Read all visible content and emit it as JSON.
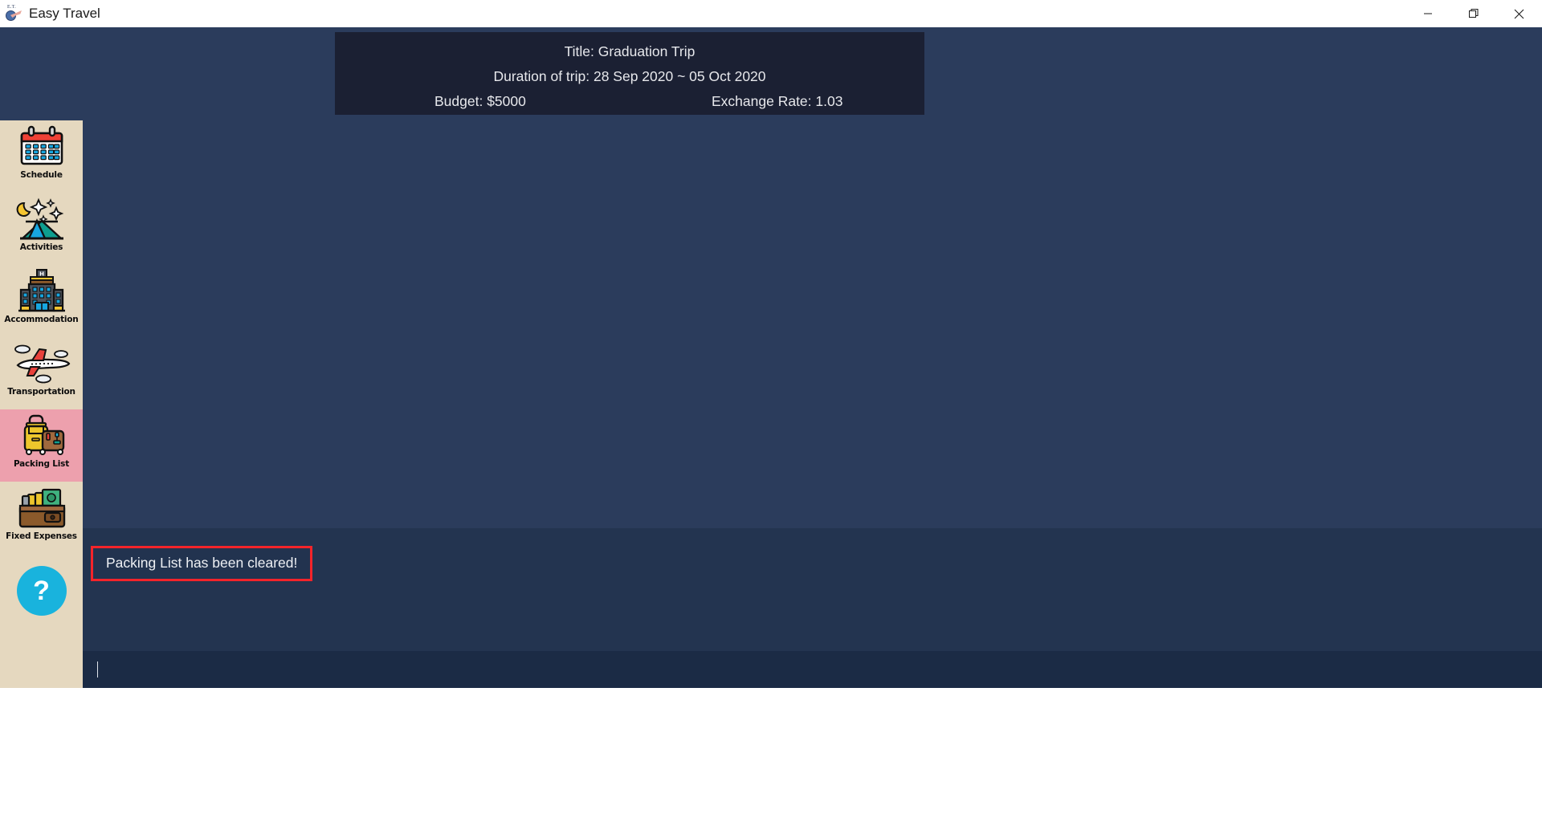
{
  "window": {
    "title": "Easy Travel",
    "icon": "app-logo-icon",
    "minimize_label": "Minimize",
    "maximize_label": "Restore",
    "close_label": "Close"
  },
  "header": {
    "title_line": "Title: Graduation Trip",
    "duration_line": "Duration of trip: 28 Sep 2020 ~ 05 Oct 2020",
    "budget_line": "Budget: $5000",
    "exchange_rate_line": "Exchange Rate: 1.03",
    "background_color": "#1b2033"
  },
  "sidebar": {
    "background_color": "#e5d8bf",
    "selected_color": "#eda0ad",
    "items": [
      {
        "label": "Schedule",
        "icon": "calendar-icon",
        "selected": false
      },
      {
        "label": "Activities",
        "icon": "tent-night-icon",
        "selected": false
      },
      {
        "label": "Accommodation",
        "icon": "hotel-building-icon",
        "selected": false
      },
      {
        "label": "Transportation",
        "icon": "airplane-icon",
        "selected": false
      },
      {
        "label": "Packing List",
        "icon": "luggage-icon",
        "selected": true
      },
      {
        "label": "Fixed Expenses",
        "icon": "wallet-money-icon",
        "selected": false
      }
    ],
    "help_button": {
      "label": "?",
      "icon": "question-mark-icon",
      "color": "#19b3dd"
    }
  },
  "log": {
    "message": "Packing List has been cleared!",
    "highlight_border_color": "#f4242a",
    "panel_color": "#233450"
  },
  "input": {
    "value": "",
    "placeholder": ""
  },
  "theme": {
    "content_background": "#2b3c5c",
    "input_background": "#1b2b45"
  }
}
